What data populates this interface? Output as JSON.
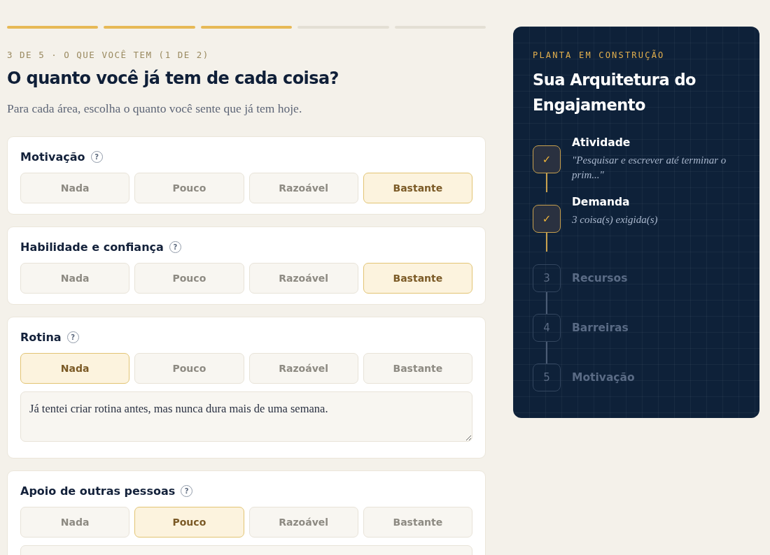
{
  "progress": [
    {
      "done": true
    },
    {
      "done": true
    },
    {
      "done": true
    },
    {
      "done": false
    },
    {
      "done": false
    }
  ],
  "eyebrow": "3 DE 5 · O QUE VOCÊ TEM (1 DE 2)",
  "heading": "O quanto você já tem de cada coisa?",
  "intro": "Para cada área, escolha o quanto você sente que já tem hoje.",
  "help_mark": "?",
  "areas": [
    {
      "title": "Motivação",
      "options": [
        {
          "label": "Nada",
          "selected": false
        },
        {
          "label": "Pouco",
          "selected": false
        },
        {
          "label": "Razoável",
          "selected": false
        },
        {
          "label": "Bastante",
          "selected": true
        }
      ],
      "note_open": false
    },
    {
      "title": "Habilidade e confiança",
      "options": [
        {
          "label": "Nada",
          "selected": false
        },
        {
          "label": "Pouco",
          "selected": false
        },
        {
          "label": "Razoável",
          "selected": false
        },
        {
          "label": "Bastante",
          "selected": true
        }
      ],
      "note_open": false
    },
    {
      "title": "Rotina",
      "options": [
        {
          "label": "Nada",
          "selected": true
        },
        {
          "label": "Pouco",
          "selected": false
        },
        {
          "label": "Razoável",
          "selected": false
        },
        {
          "label": "Bastante",
          "selected": false
        }
      ],
      "note_open": true,
      "note": "Já tentei criar rotina antes, mas nunca dura mais de uma semana."
    },
    {
      "title": "Apoio de outras pessoas",
      "options": [
        {
          "label": "Nada",
          "selected": false
        },
        {
          "label": "Pouco",
          "selected": true
        },
        {
          "label": "Razoável",
          "selected": false
        },
        {
          "label": "Bastante",
          "selected": false
        }
      ],
      "note_open": true
    }
  ],
  "panel": {
    "eyebrow": "PLANTA EM CONSTRUÇÃO",
    "title": "Sua Arquitetura do Engajamento",
    "steps": [
      {
        "kind": "done",
        "mark": "✓",
        "title": "Atividade",
        "detail": "\"Pesquisar e escrever até terminar o prim...\""
      },
      {
        "kind": "done",
        "mark": "✓",
        "title": "Demanda",
        "detail": "3 coisa(s) exigida(s)"
      },
      {
        "kind": "todo",
        "mark": "3",
        "title": "Recursos"
      },
      {
        "kind": "todo",
        "mark": "4",
        "title": "Barreiras"
      },
      {
        "kind": "todo",
        "mark": "5",
        "title": "Motivação"
      }
    ]
  }
}
